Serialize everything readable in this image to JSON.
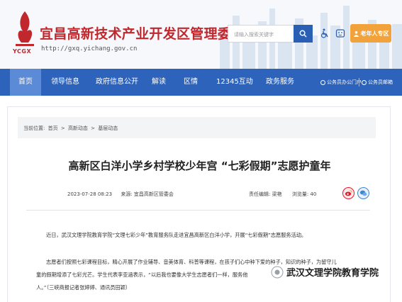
{
  "header": {
    "site_title": "宜昌高新技术产业开发区管理委员会",
    "logo_text": "YCGX",
    "url": "http://gxq.yichang.gov.cn",
    "search_placeholder": "请输入搜索关键字",
    "elder_label": "老年人专区"
  },
  "nav": {
    "items": [
      "首页",
      "领导信息",
      "政府信息公开",
      "解读",
      "区情",
      "12345互动",
      "政务服务"
    ],
    "links": [
      "公务员办公门户",
      "公务员邮箱"
    ]
  },
  "breadcrumb": {
    "prefix": "当前位置:",
    "items": [
      "首页",
      "高新动态",
      "基层动态"
    ],
    "separator": ">"
  },
  "article": {
    "title": "高新区白洋小学乡村学校少年宫 “七彩假期”志愿护童年",
    "date": "2023-07-28 08:23",
    "source": "来源: 宜昌高新区管委会",
    "editor": "责任编辑: 梁艳",
    "views": "浏览量: 40",
    "paragraphs": [
      "近日，武汉文理学院教育学院“文理七彩少年”教育服务队走进宜昌高新区白洋小学，开展“七彩假期”志愿服务活动。",
      "志愿者们按照七彩课程目标，精心开展了作业辅导、音美体育、科普等课程，在孩子们心中种下爱的种子，知识的种子，为留守儿",
      "童的假期增添了七彩光芒。学生代表李亚涵表示，“以后我也要像大学生志愿者们一样，服务他",
      "人。”（三峡商报记者张婷婷、通讯员田颖）"
    ]
  },
  "watermark": "武汉文理学院教育学院",
  "colors": {
    "brand_red": "#c0282d",
    "nav_blue": "#2e63bb",
    "nav_active": "#5b8ad6",
    "elder_orange": "#f2a23a",
    "weibo_red": "#e6162d",
    "wechat_blue": "#3a86d6"
  }
}
